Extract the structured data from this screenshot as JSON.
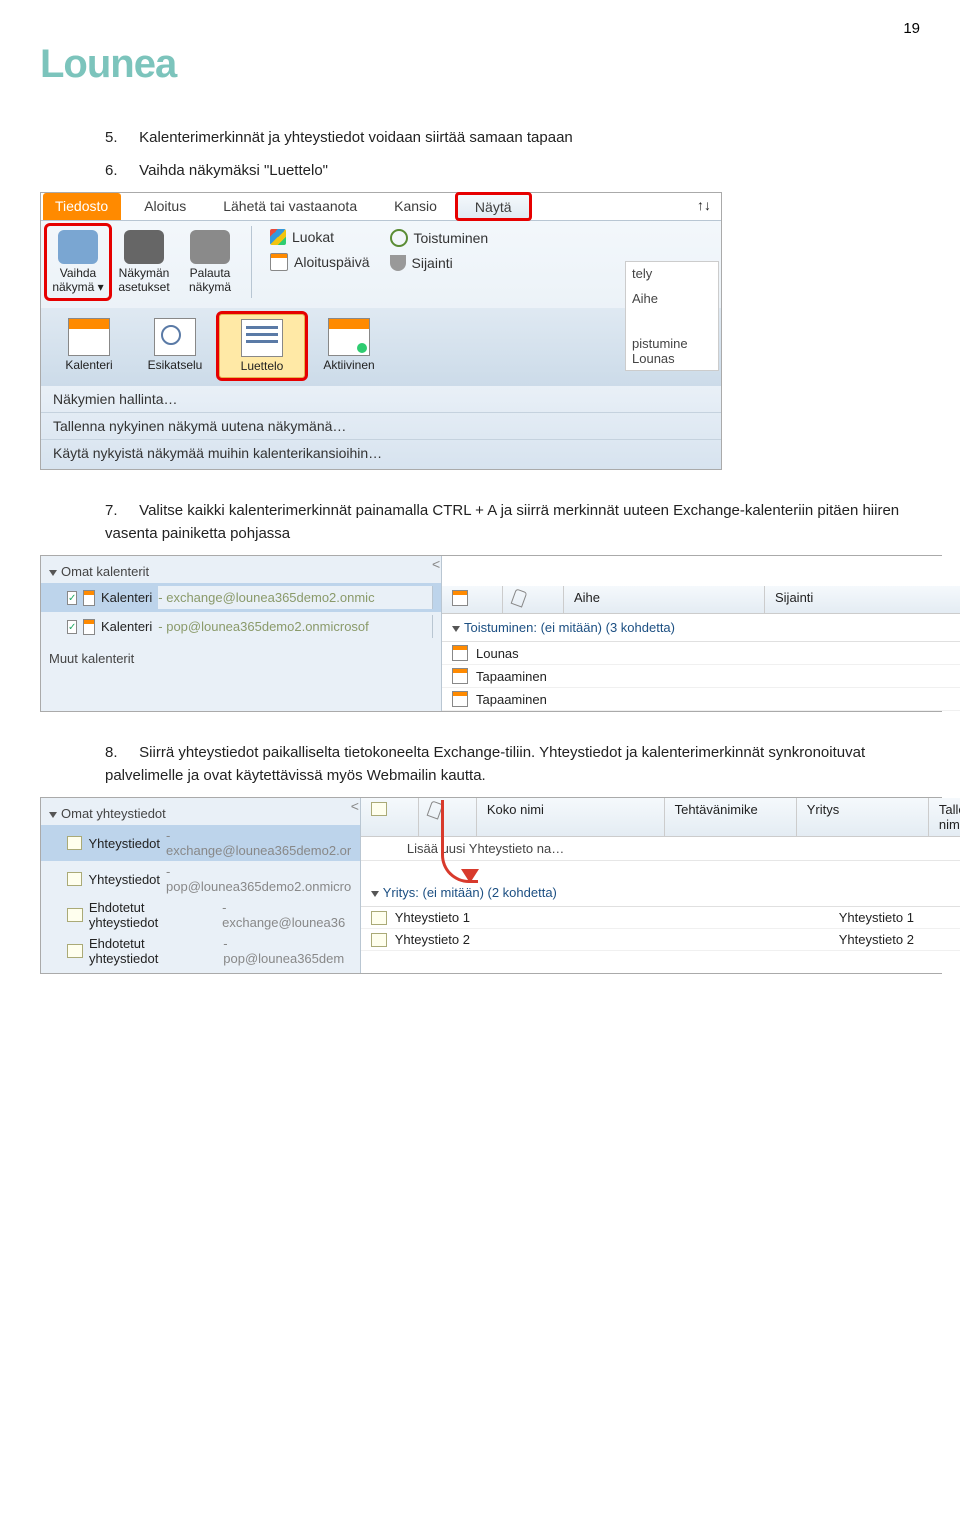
{
  "page_number": "19",
  "logo": "Lounea",
  "para5": {
    "num": "5.",
    "text": "Kalenterimerkinnät ja yhteystiedot voidaan siirtää samaan tapaan"
  },
  "para6": {
    "num": "6.",
    "text": "Vaihda näkymäksi \"Luettelo\""
  },
  "para7": {
    "num": "7.",
    "text": "Valitse kaikki kalenterimerkinnät painamalla CTRL + A ja siirrä merkinnät uuteen Exchange-kalenteriin pitäen hiiren vasenta painiketta pohjassa"
  },
  "para8": {
    "num": "8.",
    "text": "Siirrä yhteystiedot paikalliselta tietokoneelta Exchange-tiliin. Yhteystiedot ja kalenterimerkinnät synkronoituvat palvelimelle ja ovat käytettävissä myös Webmailin kautta."
  },
  "s1": {
    "tabs": {
      "file": "Tiedosto",
      "home": "Aloitus",
      "sendrecv": "Lähetä tai vastaanota",
      "folder": "Kansio",
      "view": "Näytä"
    },
    "big": {
      "change": "Vaihda näkymä ▾",
      "settings": "Näkymän asetukset",
      "reset": "Palauta näkymä"
    },
    "small": {
      "categories": "Luokat",
      "recurrence": "Toistuminen",
      "startdate": "Aloituspäivä",
      "location": "Sijainti"
    },
    "views": {
      "calendar": "Kalenteri",
      "preview": "Esikatselu",
      "list": "Luettelo",
      "active": "Aktiivinen"
    },
    "arrange": "tely",
    "menu1": "Näkymien hallinta…",
    "menu2": "Tallenna nykyinen näkymä uutena näkymänä…",
    "menu3": "Käytä nykyistä näkymää muihin kalenterikansioihin…",
    "rcol": [
      "Aihe",
      "pistumine",
      "Lounas"
    ],
    "sortarrows": "↑↓"
  },
  "s2": {
    "left_hdr": "Omat kalenterit",
    "items": [
      {
        "label": "Kalenteri",
        "sub": " - exchange@lounea365demo2.onmic",
        "sel": true,
        "chk": true
      },
      {
        "label": "Kalenteri",
        "sub": " - pop@lounea365demo2.onmicrosof",
        "sel": false,
        "chk": true
      }
    ],
    "other": "Muut kalenterit",
    "cols": {
      "icon": "",
      "attach": "",
      "subject": "Aihe",
      "location": "Sijainti"
    },
    "group": "Toistuminen: (ei mitään) (3 kohdetta)",
    "rows": [
      "Lounas",
      "Tapaaminen",
      "Tapaaminen"
    ]
  },
  "s3": {
    "left_hdr": "Omat yhteystiedot",
    "items": [
      {
        "label": "Yhteystiedot",
        "sub": " - exchange@lounea365demo2.or",
        "sel": true
      },
      {
        "label": "Yhteystiedot",
        "sub": " - pop@lounea365demo2.onmicro",
        "sel": false
      },
      {
        "label": "Ehdotetut yhteystiedot",
        "sub": " - exchange@lounea36",
        "sel": false
      },
      {
        "label": "Ehdotetut yhteystiedot",
        "sub": " - pop@lounea365dem",
        "sel": false
      }
    ],
    "cols": {
      "fullname": "Koko nimi",
      "title": "Tehtävänimike",
      "company": "Yritys",
      "filedas": "Tallennettu nimellä"
    },
    "add": "Lisää uusi Yhteystieto na…",
    "group": "Yritys: (ei mitään) (2 kohdetta)",
    "rows": [
      {
        "name": "Yhteystieto 1",
        "filed": "Yhteystieto 1"
      },
      {
        "name": "Yhteystieto 2",
        "filed": "Yhteystieto 2"
      }
    ]
  }
}
